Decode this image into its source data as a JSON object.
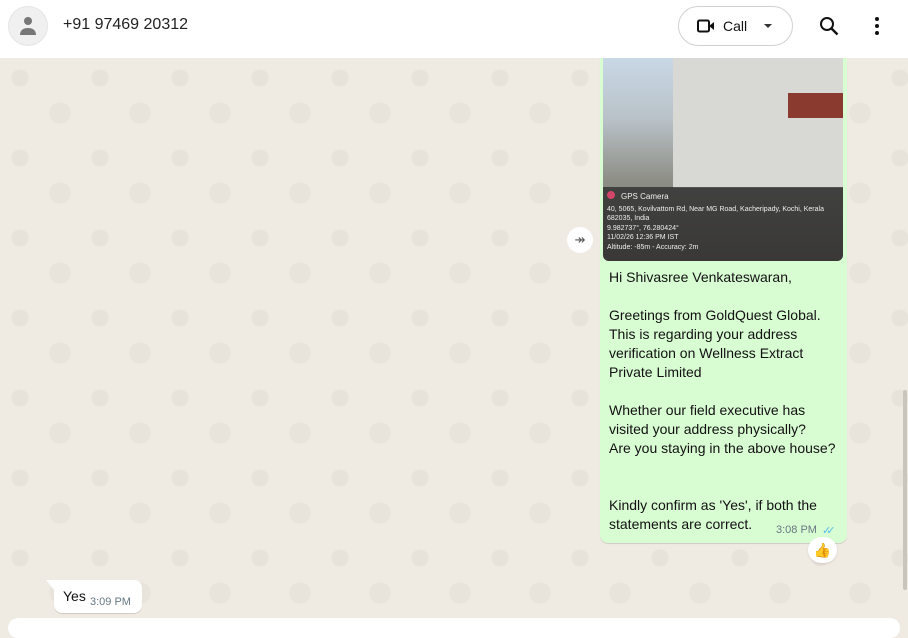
{
  "header": {
    "contact": "+91 97469 20312",
    "call_label": "Call"
  },
  "outgoing": {
    "image_overlay": {
      "app": "GPS Camera",
      "address": "40, 5065, Kovilvattom Rd, Near MG Road, Kacheripady, Kochi, Kerala 682035, India",
      "coords": "9.982737°, 76.280424°",
      "datetime": "11/02/26 12:36 PM IST",
      "altitude": "Altitude: -85m - Accuracy: 2m"
    },
    "text": "Hi Shivasree Venkateswaran,\n\nGreetings from GoldQuest Global. This is regarding your address verification on Wellness Extract Private Limited\n\nWhether our field executive has visited your address physically?\nAre you staying in the above house?\n\n\nKindly confirm as 'Yes', if both the statements are correct.",
    "time": "3:08 PM",
    "ticks": "✓✓",
    "reaction": "👍"
  },
  "incoming": {
    "text": "Yes",
    "time": "3:09 PM"
  }
}
